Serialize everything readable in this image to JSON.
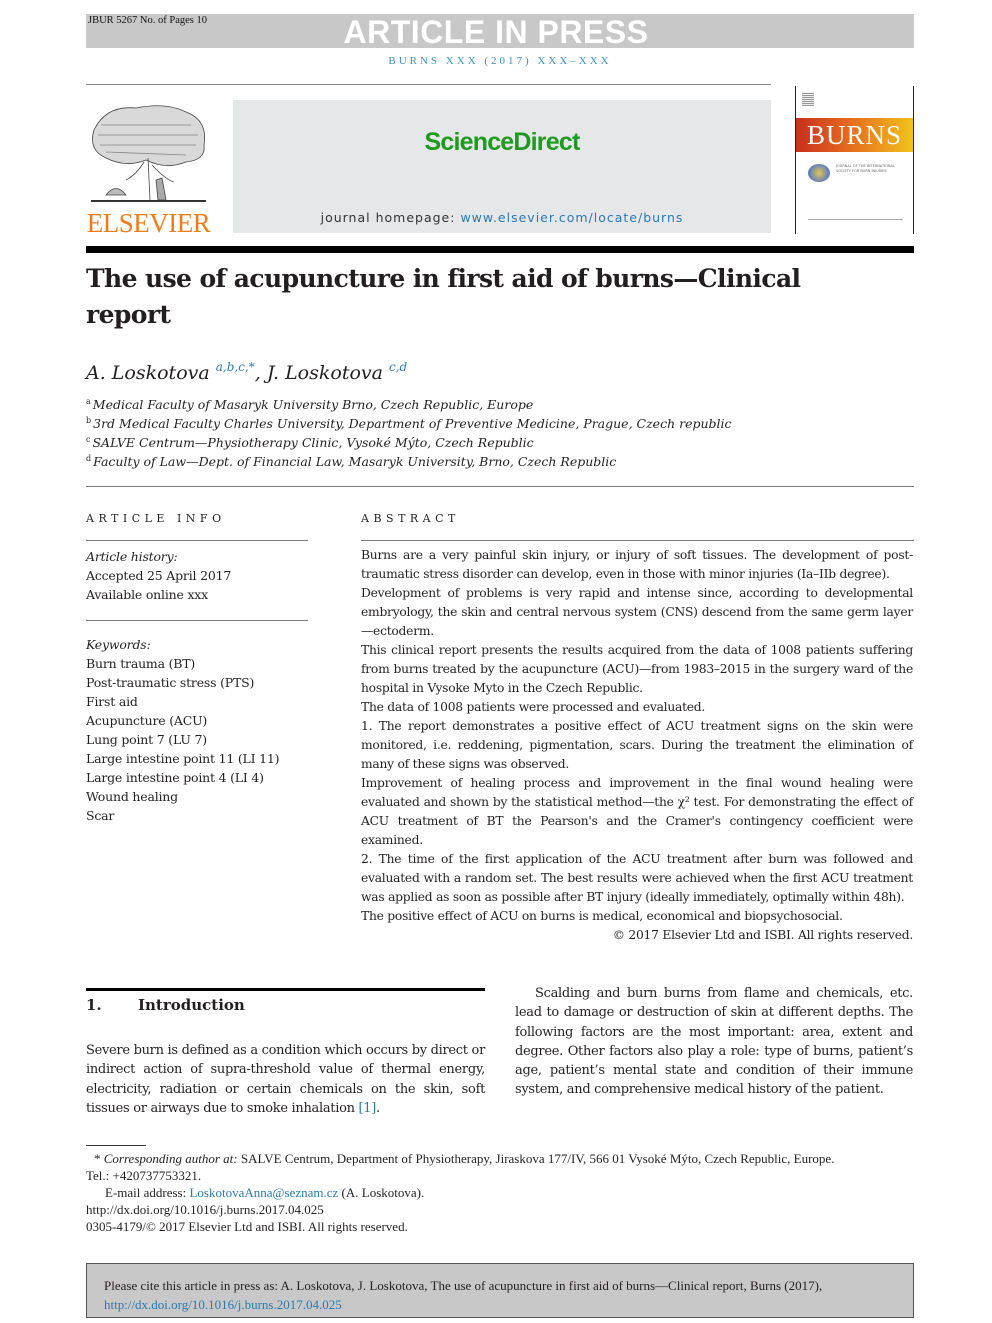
{
  "banner": {
    "ms_info": "JBUR 5267 No. of Pages 10",
    "status": "ARTICLE IN PRESS",
    "running_head": "BURNS XXX (2017) XXX–XXX"
  },
  "masthead": {
    "publisher": "ELSEVIER",
    "platform": "ScienceDirect",
    "homepage_label": "journal homepage: ",
    "homepage_url": "www.elsevier.com/locate/burns",
    "journal_cover_title": "BURNS",
    "cover_small_text": "JOURNAL OF THE INTERNATIONAL SOCIETY FOR BURN INJURIES",
    "colors": {
      "platform": "#1e9a1e",
      "publisher": "#f07b19",
      "link": "#2a7ab0"
    }
  },
  "article": {
    "title": "The use of acupuncture in first aid of burns—Clinical report",
    "authors": [
      {
        "name": "A. Loskotova",
        "affils": "a,b,c,*"
      },
      {
        "name": "J. Loskotova",
        "affils": "c,d"
      }
    ],
    "author_separator": ", ",
    "affiliations": [
      {
        "mark": "a",
        "text": "Medical Faculty of Masaryk University Brno, Czech Republic, Europe"
      },
      {
        "mark": "b",
        "text": "3rd Medical Faculty Charles University, Department of Preventive Medicine, Prague, Czech republic"
      },
      {
        "mark": "c",
        "text": "SALVE Centrum—Physiotherapy Clinic, Vysoké Mýto, Czech Republic"
      },
      {
        "mark": "d",
        "text": "Faculty of Law—Dept. of Financial Law, Masaryk University, Brno, Czech Republic"
      }
    ]
  },
  "article_info": {
    "heading": "ARTICLE INFO",
    "history_label": "Article history:",
    "history": [
      "Accepted 25 April 2017",
      "Available online xxx"
    ],
    "keywords_label": "Keywords:",
    "keywords": [
      "Burn trauma (BT)",
      "Post-traumatic stress (PTS)",
      "First aid",
      "Acupuncture (ACU)",
      "Lung point 7 (LU 7)",
      "Large intestine point 11 (LI 11)",
      "Large intestine point 4 (LI 4)",
      "Wound healing",
      "Scar"
    ]
  },
  "abstract": {
    "heading": "ABSTRACT",
    "paragraphs": [
      "Burns are a very painful skin injury, or injury of soft tissues. The development of post-traumatic stress disorder can develop, even in those with minor injuries (Ia–IIb degree).",
      "Development of problems is very rapid and intense since, according to developmental embryology, the skin and central nervous system (CNS) descend from the same germ layer—ectoderm.",
      "This clinical report presents the results acquired from the data of 1008 patients suffering from burns treated by the acupuncture (ACU)—from 1983–2015 in the surgery ward of the hospital in Vysoke Myto in the Czech Republic.",
      "The data of 1008 patients were processed and evaluated.",
      "1. The report demonstrates a positive effect of ACU treatment signs on the skin were monitored, i.e. reddening, pigmentation, scars. During the treatment the elimination of many of these signs was observed.",
      "Improvement of healing process and improvement in the final wound healing were evaluated and shown by the statistical method—the χ² test. For demonstrating the effect of ACU treatment of BT the Pearson's and the Cramer's contingency coefficient were examined.",
      "2. The time of the first application of the ACU treatment after burn was followed and evaluated with a random set. The best results were achieved when the first ACU treatment was applied as soon as possible after BT injury (ideally immediately, optimally within 48h).",
      "The positive effect of ACU on burns is medical, economical and biopsychosocial."
    ],
    "copyright": "© 2017 Elsevier Ltd and ISBI. All rights reserved."
  },
  "introduction": {
    "number": "1.",
    "title": "Introduction",
    "left_text": "Severe burn is defined as a condition which occurs by direct or indirect action of supra-threshold value of thermal energy, electricity, radiation or certain chemicals on the skin, soft tissues or airways due to smoke inhalation ",
    "left_ref": "[1]",
    "left_end": ".",
    "right_text": "Scalding and burn burns from flame and chemicals, etc. lead to damage or destruction of skin at different depths. The following factors are the most important: area, extent and degree. Other factors also play a role: type of burns, patient’s age, patient’s mental state and condition of their immune system, and comprehensive medical history of the patient."
  },
  "footnotes": {
    "corr_mark": "*",
    "corr_label": "Corresponding author at:",
    "corr_text": " SALVE Centrum, Department of Physiotherapy, Jiraskova 177/IV, 566 01 Vysoké Mýto, Czech Republic, Europe.",
    "tel": "Tel.: +420737753321.",
    "email_label": "E-mail address: ",
    "email": "LoskotovaAnna@seznam.cz",
    "email_suffix": " (A.  Loskotova).",
    "doi": "http://dx.doi.org/10.1016/j.burns.2017.04.025",
    "issn": "0305-4179/© 2017 Elsevier Ltd and ISBI. All rights reserved."
  },
  "citation_box": {
    "text": "Please cite this article in press as: A. Loskotova, J. Loskotova, The use of acupuncture in first aid of burns—Clinical report, Burns (2017),",
    "doi": "http://dx.doi.org/10.1016/j.burns.2017.04.025"
  }
}
